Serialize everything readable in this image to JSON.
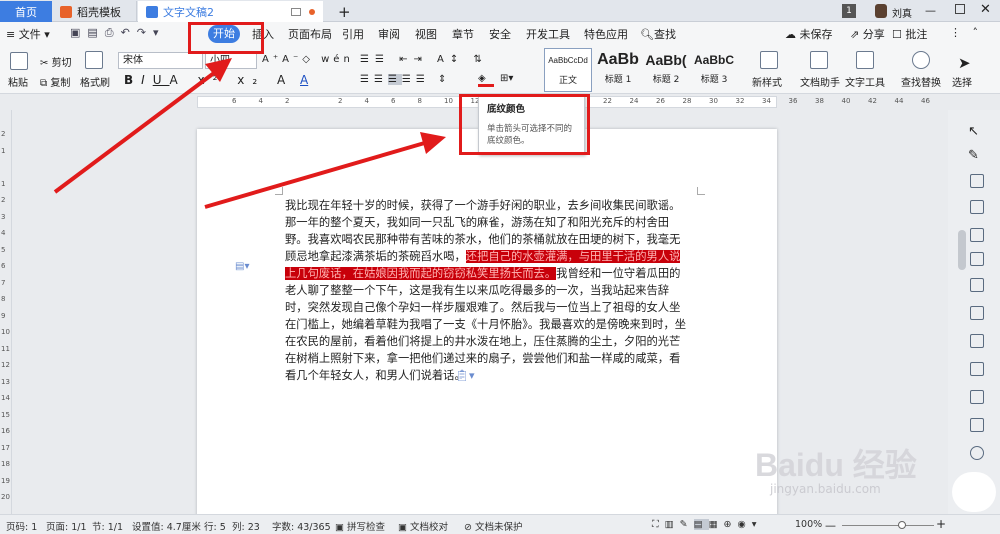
{
  "tabs": {
    "home": "首页",
    "template": "稻壳模板",
    "document": "文字文稿2",
    "add": "+"
  },
  "titlebar": {
    "badge": "1",
    "user": "刘真"
  },
  "menu": {
    "file": "文件",
    "items": [
      "开始",
      "插入",
      "页面布局",
      "引用",
      "审阅",
      "视图",
      "章节",
      "安全",
      "开发工具",
      "特色应用"
    ],
    "search": "查找",
    "unsaved": "未保存",
    "share": "分享",
    "comment": "批注"
  },
  "ribbon": {
    "paste": "粘贴",
    "cut": "剪切",
    "copy": "复制",
    "format_painter": "格式刷",
    "font_name": "宋体",
    "font_size": "小四",
    "styles": [
      {
        "sample": "AaBbCcDd",
        "label": "正文"
      },
      {
        "sample": "AaBb",
        "label": "标题 1"
      },
      {
        "sample": "AaBb(",
        "label": "标题 2"
      },
      {
        "sample": "AaBbC",
        "label": "标题 3"
      }
    ],
    "new_style": "新样式",
    "doc_helper": "文档助手",
    "text_tools": "文字工具",
    "find_replace": "查找替换",
    "select": "选择"
  },
  "ruler_numbers": [
    "6",
    "4",
    "2",
    "",
    "2",
    "4",
    "6",
    "8",
    "10",
    "12",
    "14",
    "16",
    "18",
    "20",
    "22",
    "24",
    "26",
    "28",
    "30",
    "32",
    "34",
    "36",
    "38",
    "40",
    "42",
    "44",
    "46"
  ],
  "vruler_numbers": [
    "2",
    "1",
    "",
    "1",
    "2",
    "3",
    "4",
    "5",
    "6",
    "7",
    "8",
    "9",
    "10",
    "11",
    "12",
    "13",
    "14",
    "15",
    "16",
    "17",
    "18",
    "19",
    "20"
  ],
  "tooltip": {
    "title": "底纹颜色",
    "desc": "单击箭头可选择不同的底纹颜色。"
  },
  "document": {
    "p1": "我比现在年轻十岁的时候，获得了一个游手好闲的职业，去乡间收集民间歌谣。那一年的整个夏天，我如同一只乱飞的麻雀，游荡在知了和阳光充斥的村舍田野。我喜欢喝农民那种带有苦味的茶水，他们的茶桶就放在田埂的树下，我毫无顾忌地拿起漆满茶垢的茶碗舀水喝，",
    "highlighted": "还把自己的水壶灌满，与田里干活的男人说上几句废话，在姑娘因我而起的窃窃私笑里扬长而去。",
    "p2": "我曾经和一位守着瓜田的老人聊了整整一个下午，这是我有生以来瓜吃得最多的一次，当我站起来告辞时，突然发现自己像个孕妇一样步履艰难了。然后我与一位当上了祖母的女人坐在门槛上，她编着草鞋为我唱了一支《十月怀胎》。我最喜欢的是傍晚来到时，坐在农民的屋前，看着他们将提上的井水泼在地上，压住蒸腾的尘土，夕阳的光芒在树梢上照射下来，拿一把他们递过来的扇子，尝尝他们和盐一样咸的咸菜，看看几个年轻女人，和男人们说着话。"
  },
  "status": {
    "page": "页码: 1",
    "pages": "页面: 1/1",
    "section": "节: 1/1",
    "setting": "设置值: 4.7厘米",
    "row": "行: 5",
    "col": "列: 23",
    "words": "字数: 43/365",
    "spell": "拼写检查",
    "proof": "文档校对",
    "protect": "文档未保护",
    "zoom": "100%"
  },
  "watermark": {
    "brand": "Baidu 经验",
    "url": "jingyan.baidu.com"
  },
  "colors": {
    "accent": "#3d7de1",
    "highlight": "#c8000a",
    "annotation": "#e11b1b"
  }
}
